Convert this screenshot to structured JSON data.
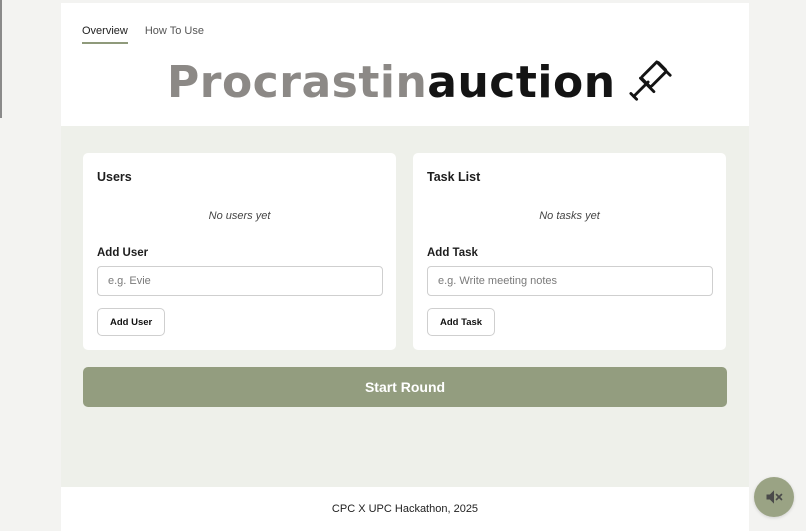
{
  "tabs": [
    {
      "label": "Overview",
      "active": true
    },
    {
      "label": "How To Use",
      "active": false
    }
  ],
  "logo": {
    "part1": "Procrastin",
    "part2": "auction",
    "icon": "gavel-icon"
  },
  "users": {
    "title": "Users",
    "empty_text": "No users yet",
    "add_label": "Add User",
    "input_placeholder": "e.g. Evie",
    "input_value": "",
    "button_label": "Add User"
  },
  "tasks": {
    "title": "Task List",
    "empty_text": "No tasks yet",
    "add_label": "Add Task",
    "input_placeholder": "e.g. Write meeting notes",
    "input_value": "",
    "button_label": "Add Task"
  },
  "start_button": "Start Round",
  "footer": "CPC X UPC Hackathon, 2025",
  "sound_button": {
    "icon": "speaker-muted-icon"
  },
  "colors": {
    "accent": "#939d7f",
    "page_bg": "#eef0ea",
    "logo_light": "#8c8986",
    "logo_dark": "#141414"
  }
}
